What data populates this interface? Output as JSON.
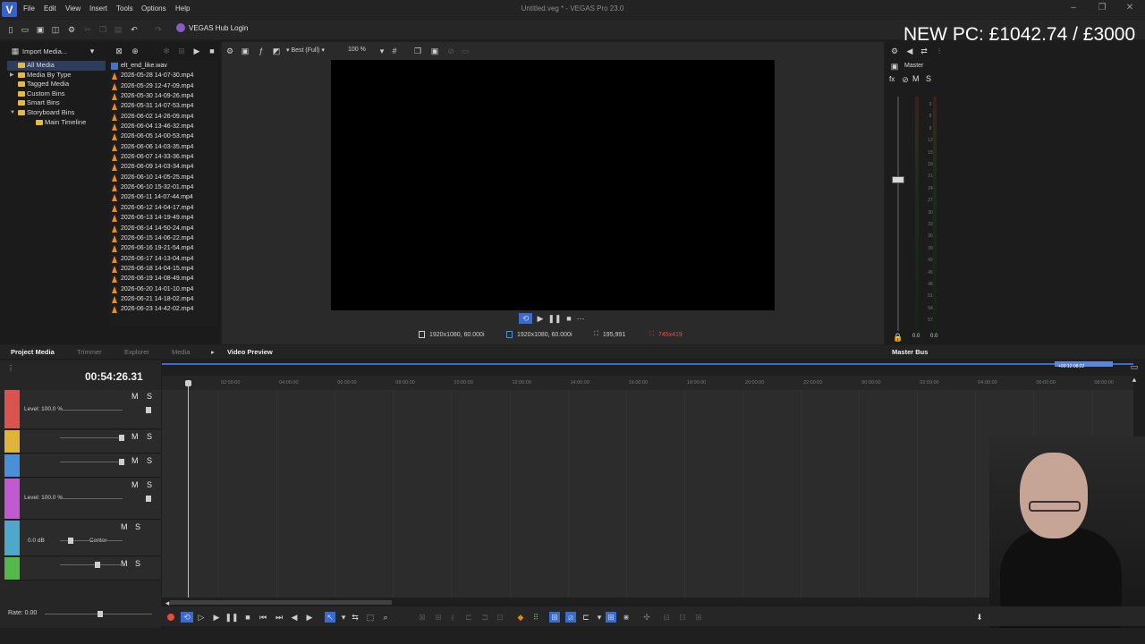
{
  "app": {
    "window_title": "Untitled.veg * - VEGAS Pro 23.0",
    "logo_letter": "V",
    "menu": [
      "File",
      "Edit",
      "View",
      "Insert",
      "Tools",
      "Options",
      "Help"
    ],
    "hub_login": "VEGAS Hub Login"
  },
  "overlay": {
    "text": "NEW PC: £1042.74 / £3000"
  },
  "media_toolbar": {
    "import_label": "Import Media..."
  },
  "tree": [
    {
      "label": "All Media",
      "selected": true,
      "expand": ""
    },
    {
      "label": "Media By Type",
      "selected": false,
      "expand": "▶"
    },
    {
      "label": "Tagged Media",
      "selected": false,
      "expand": ""
    },
    {
      "label": "Custom Bins",
      "selected": false,
      "expand": ""
    },
    {
      "label": "Smart Bins",
      "selected": false,
      "expand": ""
    },
    {
      "label": "Storyboard Bins",
      "selected": false,
      "expand": "▼"
    },
    {
      "label": "Main Timeline",
      "selected": false,
      "expand": ""
    }
  ],
  "files": [
    {
      "name": "elt_end_like.wav",
      "type": "wav"
    },
    {
      "name": "2026-05-28 14-07-30.mp4",
      "type": "mp4"
    },
    {
      "name": "2026-05-29 12-47-09.mp4",
      "type": "mp4"
    },
    {
      "name": "2026-05-30 14-09-26.mp4",
      "type": "mp4"
    },
    {
      "name": "2026-05-31 14-07-53.mp4",
      "type": "mp4"
    },
    {
      "name": "2026-06-02 14-26-09.mp4",
      "type": "mp4"
    },
    {
      "name": "2026-06-04 13-46-32.mp4",
      "type": "mp4"
    },
    {
      "name": "2026-06-05 14-00-53.mp4",
      "type": "mp4"
    },
    {
      "name": "2026-06-06 14-03-35.mp4",
      "type": "mp4"
    },
    {
      "name": "2026-06-07 14-33-36.mp4",
      "type": "mp4"
    },
    {
      "name": "2026-06-09 14-03-34.mp4",
      "type": "mp4"
    },
    {
      "name": "2026-06-10 14-05-25.mp4",
      "type": "mp4"
    },
    {
      "name": "2026-06-10 15-32-01.mp4",
      "type": "mp4"
    },
    {
      "name": "2026-06-11 14-07-44.mp4",
      "type": "mp4"
    },
    {
      "name": "2026-06-12 14-04-17.mp4",
      "type": "mp4"
    },
    {
      "name": "2026-06-13 14-19-49.mp4",
      "type": "mp4"
    },
    {
      "name": "2026-06-14 14-50-24.mp4",
      "type": "mp4"
    },
    {
      "name": "2026-06-15 14-06-22.mp4",
      "type": "mp4"
    },
    {
      "name": "2026-06-16 19-21-54.mp4",
      "type": "mp4"
    },
    {
      "name": "2026-06-17 14-13-04.mp4",
      "type": "mp4"
    },
    {
      "name": "2026-06-18 14-04-15.mp4",
      "type": "mp4"
    },
    {
      "name": "2026-06-19 14-08-49.mp4",
      "type": "mp4"
    },
    {
      "name": "2026-06-20 14-01-10.mp4",
      "type": "mp4"
    },
    {
      "name": "2026-06-21 14-18-02.mp4",
      "type": "mp4"
    },
    {
      "name": "2026-06-23 14-42-02.mp4",
      "type": "mp4"
    }
  ],
  "preview": {
    "quality": "Best (Full)",
    "zoom": "100 %",
    "project_props": "1920x1080, 60.000i",
    "preview_props": "1920x1080, 60.000i",
    "frame": "195,991",
    "display": "745x419"
  },
  "master_bus": {
    "label": "Master",
    "title": "Master Bus",
    "meter_ticks": [
      "3",
      "6",
      "9",
      "12",
      "15",
      "18",
      "21",
      "24",
      "27",
      "30",
      "33",
      "36",
      "39",
      "42",
      "45",
      "48",
      "51",
      "54",
      "57"
    ],
    "peak_l": "0.0",
    "peak_r": "0.0"
  },
  "tabs": {
    "project_media": "Project Media",
    "trimmer": "Trimmer",
    "explorer": "Explorer",
    "media": "Media",
    "video_preview": "Video Preview",
    "master_bus": "Master Bus"
  },
  "timeline": {
    "timecode": "00:54:26.31",
    "cursor_badge": "+00:12:08;22",
    "rate": "Rate: 0.00",
    "ruler": [
      "02:00:00",
      "04:00:00",
      "06:00:00",
      "08:00:00",
      "10:00:00",
      "12:00:00",
      "14:00:00",
      "16:00:00",
      "18:00:00",
      "20:00:00",
      "22:00:00",
      "00:00:00",
      "02:00:00",
      "04:00:00",
      "06:00:00",
      "08:00:00"
    ],
    "tracks": [
      {
        "color": "#d9534f",
        "level": "Level: 100.0 %",
        "m": "M",
        "s": "S"
      },
      {
        "color": "#e0b43a",
        "level": "",
        "m": "M",
        "s": "S"
      },
      {
        "color": "#4a8fd9",
        "level": "",
        "m": "M",
        "s": "S"
      },
      {
        "color": "#c05ad0",
        "level": "Level: 100.0 %",
        "m": "M",
        "s": "S"
      },
      {
        "color": "#4fa8c9",
        "level": "0.0 dB",
        "pan": "Center",
        "m": "M",
        "s": "S"
      },
      {
        "color": "#55b84a",
        "level": "",
        "m": "M",
        "s": "S"
      }
    ]
  },
  "colors": {
    "accent": "#3a6ccf",
    "record": "#e84c3d"
  }
}
